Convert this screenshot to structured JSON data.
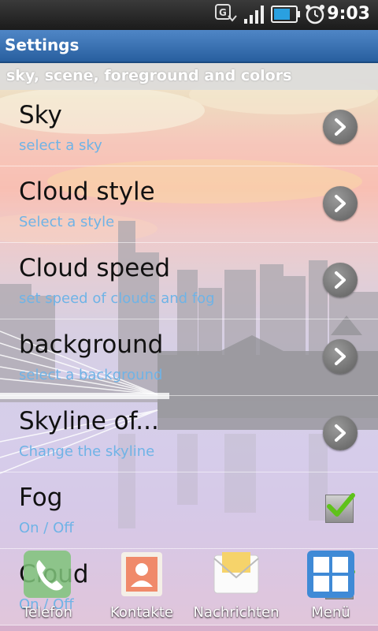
{
  "status_bar": {
    "time": "9:03",
    "icons": [
      "gps-sync-icon",
      "signal-icon",
      "battery-icon",
      "alarm-icon"
    ]
  },
  "app": {
    "title": "Settings"
  },
  "section": {
    "header": "sky, scene, foreground and colors"
  },
  "items": [
    {
      "label": "Sky",
      "sub": "select a sky",
      "control": "chevron"
    },
    {
      "label": "Cloud style",
      "sub": "Select a style",
      "control": "chevron"
    },
    {
      "label": "Cloud speed",
      "sub": "set speed of clouds and fog",
      "control": "chevron"
    },
    {
      "label": "background",
      "sub": "select a background",
      "control": "chevron"
    },
    {
      "label": "Skyline of...",
      "sub": "Change the skyline",
      "control": "chevron"
    },
    {
      "label": "Fog",
      "sub": "On / Off",
      "control": "checkbox",
      "checked": true
    },
    {
      "label": "Cloud",
      "sub": "On / Off",
      "control": "checkbox",
      "checked": true
    }
  ],
  "dock": [
    {
      "label": "Telefon",
      "icon": "phone-icon"
    },
    {
      "label": "Kontakte",
      "icon": "contacts-icon"
    },
    {
      "label": "Nachrichten",
      "icon": "messages-icon"
    },
    {
      "label": "Menü",
      "icon": "menu-grid-icon"
    }
  ],
  "colors": {
    "title_bar": "#285f9f",
    "subtitle": "#6fb3e6",
    "check": "#5fc21a"
  }
}
